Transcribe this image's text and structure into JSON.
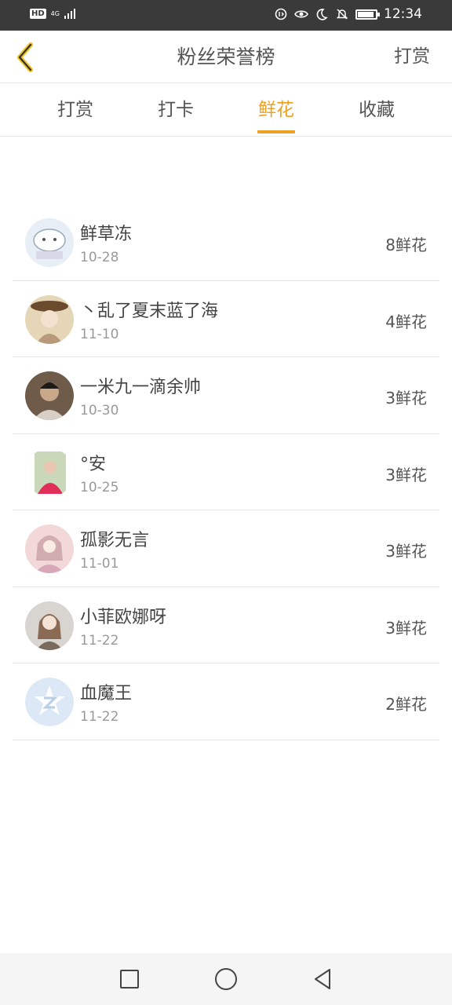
{
  "status_bar": {
    "hd_label": "HD",
    "network": "4G",
    "time": "12:34",
    "battery_level": 0.9,
    "icons": [
      "hd-icon",
      "signal-icon",
      "data-saver-icon",
      "eye-icon",
      "moon-icon",
      "bell-off-icon",
      "battery-icon"
    ]
  },
  "header": {
    "title": "粉丝荣誉榜",
    "action_label": "打赏",
    "back_icon": "chevron-left-icon",
    "accent_color": "#f0a020"
  },
  "tabs": [
    {
      "label": "打赏",
      "active": false
    },
    {
      "label": "打卡",
      "active": false
    },
    {
      "label": "鲜花",
      "active": true
    },
    {
      "label": "收藏",
      "active": false
    }
  ],
  "fans": [
    {
      "name": "鲜草冻",
      "date": "10-28",
      "count": "8鲜花"
    },
    {
      "name": "丶乱了夏末蓝了海",
      "date": "11-10",
      "count": "4鲜花"
    },
    {
      "name": "一米九一滴余帅",
      "date": "10-30",
      "count": "3鲜花"
    },
    {
      "name": "°安",
      "date": "10-25",
      "count": "3鲜花"
    },
    {
      "name": "孤影无言",
      "date": "11-01",
      "count": "3鲜花"
    },
    {
      "name": "小菲欧娜呀",
      "date": "11-22",
      "count": "3鲜花"
    },
    {
      "name": "血魔王",
      "date": "11-22",
      "count": "2鲜花"
    }
  ],
  "nav_bar": {
    "icons": [
      "square-recents-icon",
      "circle-home-icon",
      "triangle-back-icon"
    ]
  }
}
